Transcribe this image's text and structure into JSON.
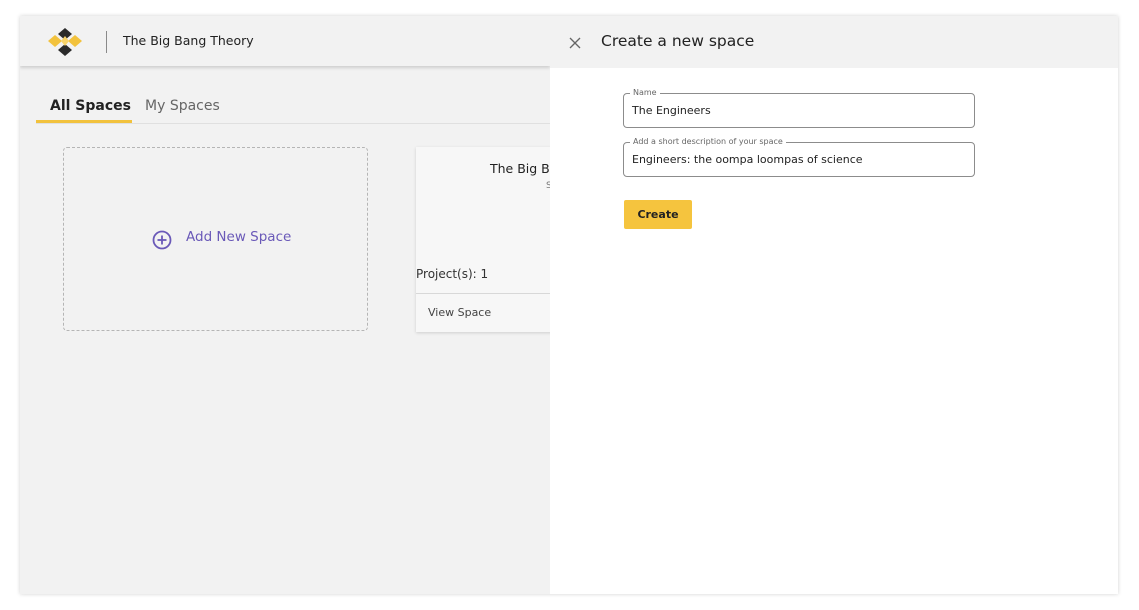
{
  "header": {
    "app_title": "The Big Bang Theory",
    "logo_icon": "cubes-logo-icon"
  },
  "tabs": [
    {
      "label": "All Spaces",
      "active": true
    },
    {
      "label": "My Spaces",
      "active": false
    }
  ],
  "add_space": {
    "label": "Add New Space",
    "icon": "plus-circle-icon"
  },
  "space_card": {
    "name": "The Big Ba",
    "subtitle": "S",
    "projects_text": "Project(s): 1",
    "view_label": "View Space"
  },
  "panel": {
    "title": "Create a new space",
    "close_icon": "close-icon",
    "name_field": {
      "label": "Name",
      "value": "The Engineers"
    },
    "description_field": {
      "label": "Add a short description of your space",
      "value": "Engineers: the oompa loompas of science"
    },
    "create_label": "Create"
  },
  "colors": {
    "accent": "#f2c23d",
    "button": "#f5c43e",
    "link": "#6a59b8",
    "logo_dark": "#2a2a2a"
  }
}
